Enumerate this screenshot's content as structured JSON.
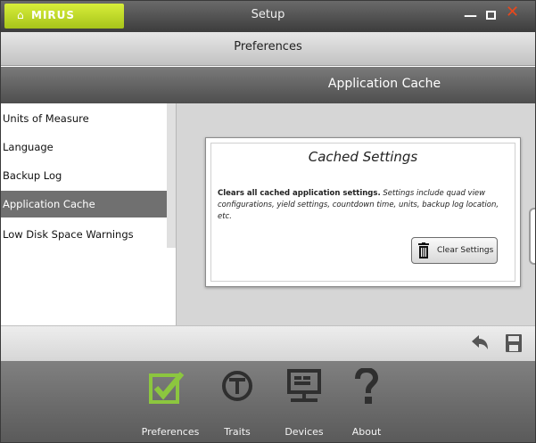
{
  "window": {
    "logo_text": "MIRUS",
    "title": "Setup",
    "minimize_glyph": "—",
    "close_glyph": "✕"
  },
  "header": {
    "title": "Preferences"
  },
  "section": {
    "title": "Application Cache"
  },
  "sidebar": {
    "items": [
      {
        "label": "Units of Measure"
      },
      {
        "label": "Language"
      },
      {
        "label": "Backup Log"
      },
      {
        "label": "Application Cache",
        "selected": true
      },
      {
        "label": "Low Disk Space Warnings"
      }
    ]
  },
  "card": {
    "title": "Cached Settings",
    "desc_bold": "Clears all cached application settings.",
    "desc_italic": "Settings include quad view configurations, yield settings, countdown time, units, backup log location, etc.",
    "button_label": "Clear Settings"
  },
  "nav": {
    "items": [
      {
        "label": "Preferences",
        "icon": "checkbox-icon"
      },
      {
        "label": "Traits",
        "icon": "traits-icon"
      },
      {
        "label": "Devices",
        "icon": "monitor-icon"
      },
      {
        "label": "About",
        "icon": "question-icon"
      }
    ]
  },
  "colors": {
    "accent": "#c8e02a",
    "close": "#e8481c",
    "selected_bg": "#707070"
  }
}
